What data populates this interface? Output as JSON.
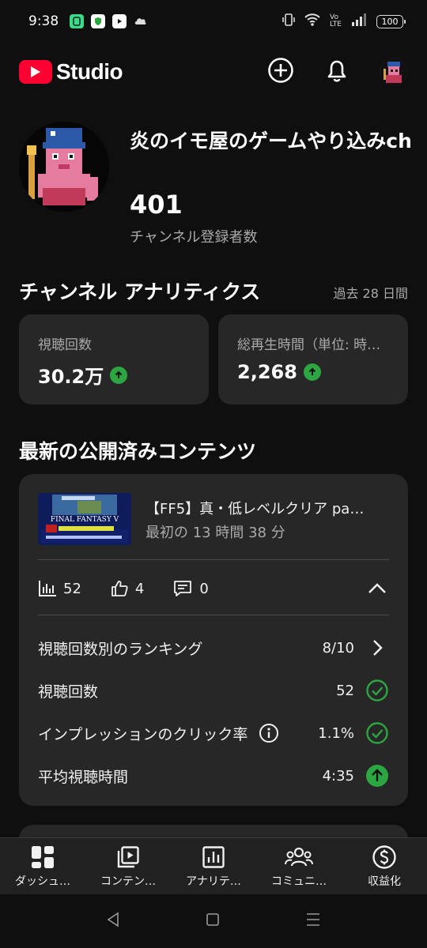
{
  "status_bar": {
    "time": "9:38",
    "battery": "100"
  },
  "header": {
    "brand": "Studio"
  },
  "channel": {
    "name": "炎のイモ屋のゲームやり込みch",
    "subscribers": "401",
    "subscribers_label": "チャンネル登録者数"
  },
  "analytics": {
    "title": "チャンネル アナリティクス",
    "period": "過去 28 日間",
    "metrics": [
      {
        "label": "視聴回数",
        "value": "30.2万"
      },
      {
        "label": "総再生時間（単位: 時…",
        "value": "2,268"
      }
    ]
  },
  "latest": {
    "title": "最新の公開済みコンテンツ",
    "video_title": "【FF5】真・低レベルクリア pa…",
    "video_subtitle": "最初の 13 時間 38 分",
    "thumbnail_text": "FINAL FANTASY V",
    "stats": {
      "views": "52",
      "likes": "4",
      "comments": "0"
    },
    "rows": [
      {
        "label": "視聴回数別のランキング",
        "value": "8/10"
      },
      {
        "label": "視聴回数",
        "value": "52"
      },
      {
        "label": "インプレッションのクリック率",
        "value": "1.1%"
      },
      {
        "label": "平均視聴時間",
        "value": "4:35"
      }
    ]
  },
  "nav": [
    {
      "label": "ダッシュ…",
      "icon": "dashboard-icon"
    },
    {
      "label": "コンテン…",
      "icon": "content-icon"
    },
    {
      "label": "アナリテ…",
      "icon": "analytics-icon"
    },
    {
      "label": "コミュニ…",
      "icon": "community-icon"
    },
    {
      "label": "収益化",
      "icon": "earn-icon"
    }
  ],
  "colors": {
    "accent_red": "#ff0033",
    "success_green": "#2ba640",
    "card": "#272727",
    "background": "#0f0f0f"
  }
}
